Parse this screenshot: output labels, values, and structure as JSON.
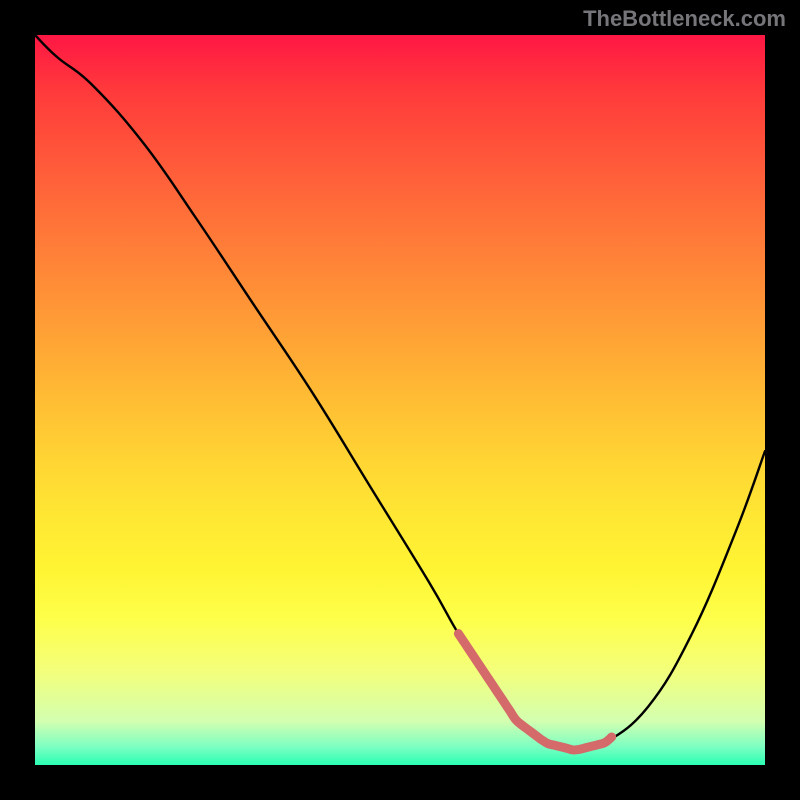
{
  "watermark": "TheBottleneck.com",
  "colors": {
    "page_bg": "#000000",
    "gradient_top": "#ff1744",
    "gradient_bottom": "#29ffb3",
    "curve": "#000000",
    "highlight": "#d46a6a",
    "watermark_text": "#75757a"
  },
  "chart_data": {
    "type": "line",
    "title": "",
    "xlabel": "",
    "ylabel": "",
    "xlim": [
      0,
      100
    ],
    "ylim": [
      0,
      100
    ],
    "x": [
      0,
      3,
      8,
      15,
      22,
      30,
      38,
      46,
      54,
      58,
      62,
      66,
      70,
      74,
      78,
      84,
      90,
      96,
      100
    ],
    "values": [
      100,
      97,
      93,
      85,
      75,
      63,
      51,
      38,
      25,
      18,
      12,
      6,
      3,
      2,
      3,
      8,
      18,
      32,
      43
    ],
    "highlight_range": [
      58,
      79
    ],
    "axes_visible": false,
    "grid": false
  }
}
